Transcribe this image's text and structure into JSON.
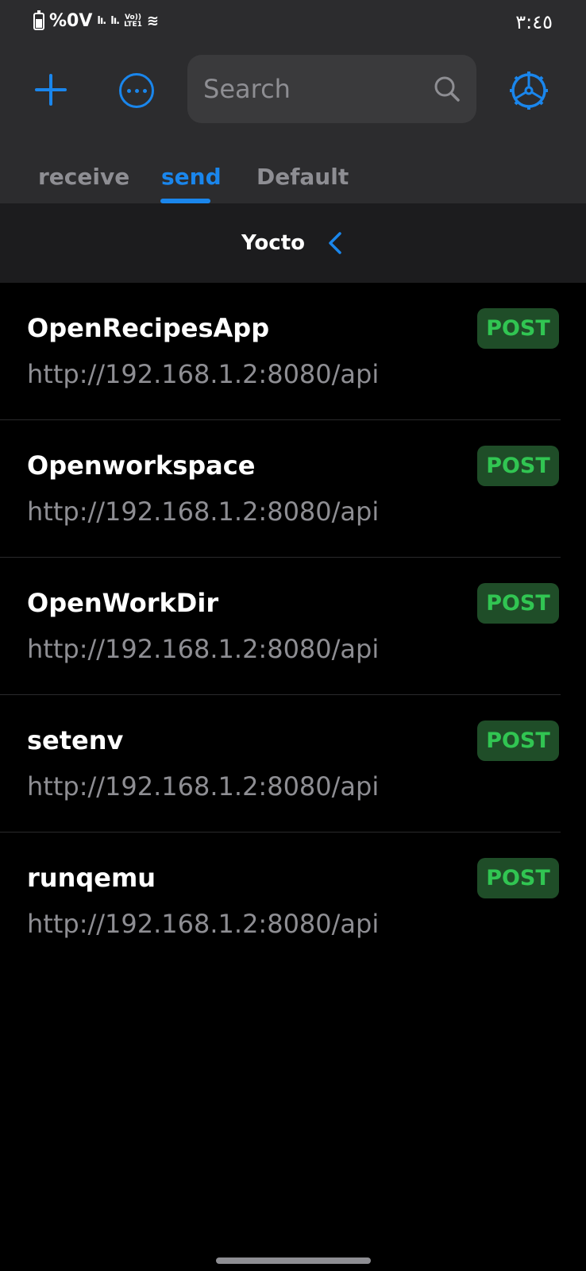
{
  "status_bar": {
    "battery": "%0V",
    "signal_1": "lı.",
    "signal_2": "lı.",
    "volte_top": "Vo))",
    "volte_bottom": "LTE1",
    "wifi": "≋",
    "time": "٣:٤٥"
  },
  "header": {
    "search": {
      "placeholder": "Search"
    },
    "tabs": [
      {
        "label": "receive",
        "active": false
      },
      {
        "label": "send",
        "active": true
      },
      {
        "label": "Default",
        "active": false
      }
    ]
  },
  "folder": {
    "title": "Yocto"
  },
  "requests": [
    {
      "name": "OpenRecipesApp",
      "url": "http://192.168.1.2:8080/api",
      "method": "POST"
    },
    {
      "name": "Openworkspace",
      "url": "http://192.168.1.2:8080/api",
      "method": "POST"
    },
    {
      "name": "OpenWorkDir",
      "url": "http://192.168.1.2:8080/api",
      "method": "POST"
    },
    {
      "name": "setenv",
      "url": "http://192.168.1.2:8080/api",
      "method": "POST"
    },
    {
      "name": "runqemu",
      "url": "http://192.168.1.2:8080/api",
      "method": "POST"
    }
  ],
  "colors": {
    "accent": "#1a86ec",
    "post_text": "#31c552",
    "post_bg": "#1f4d28",
    "header_bg": "#2c2c2e",
    "background": "#000000"
  },
  "icons": {
    "add": "plus-icon",
    "more": "more-icon",
    "search": "search-icon",
    "settings": "gear-icon",
    "back": "chevron-left-icon"
  }
}
